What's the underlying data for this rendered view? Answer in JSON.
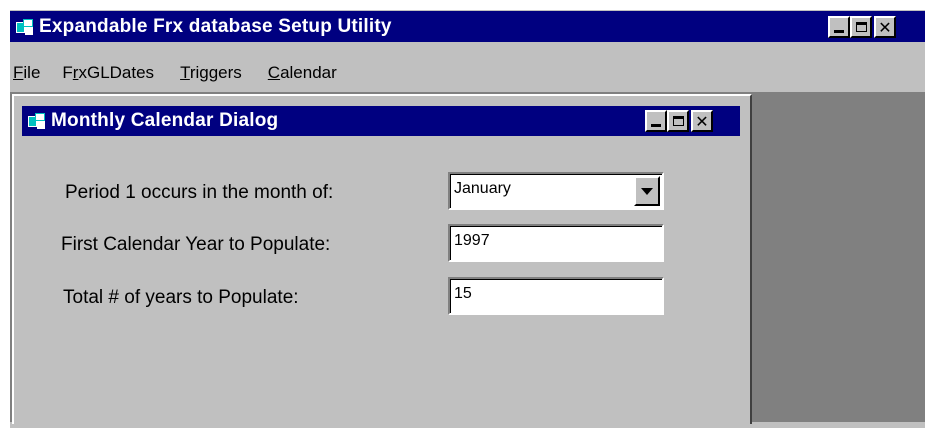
{
  "app": {
    "title": "Expandable Frx database Setup Utility"
  },
  "menu": {
    "items": [
      {
        "underline": "F",
        "rest": "ile"
      },
      {
        "prefix": "F",
        "underline": "r",
        "rest": "xGLDates"
      },
      {
        "underline": "T",
        "rest": "riggers"
      },
      {
        "underline": "C",
        "rest": "alendar"
      }
    ]
  },
  "dialog": {
    "title": "Monthly Calendar Dialog",
    "period_label": "Period 1 occurs in the month of:",
    "period_value": "January",
    "first_year_label": "First Calendar Year to Populate:",
    "first_year_value": "1997",
    "total_years_label": "Total # of years to Populate:",
    "total_years_value": "15"
  }
}
